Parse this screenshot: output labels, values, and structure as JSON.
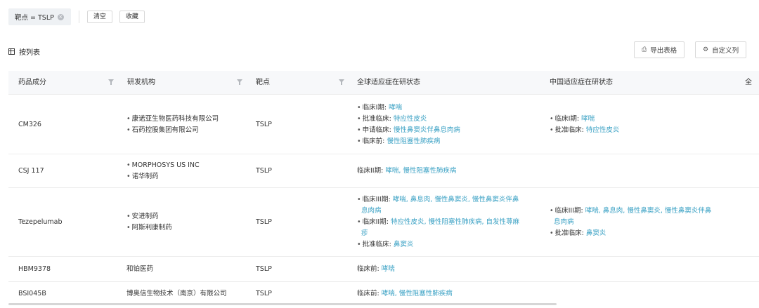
{
  "filter": {
    "tag": "靶点 = TSLP",
    "clear_label": "清空",
    "favorite_label": "收藏"
  },
  "section": {
    "title": "按列表"
  },
  "actions": {
    "export_label": "导出表格",
    "customize_label": "自定义列"
  },
  "table": {
    "columns": [
      "药品成分",
      "研发机构",
      "靶点",
      "全球适应症在研状态",
      "中国适应症在研状态",
      "全"
    ],
    "rows": [
      {
        "drug": "CM326",
        "orgs": [
          "康诺亚生物医药科技有限公司",
          "石药控股集团有限公司"
        ],
        "target": "TSLP",
        "global": [
          {
            "phase": "临床I期:",
            "indications": "哮喘"
          },
          {
            "phase": "批准临床:",
            "indications": "特应性皮炎"
          },
          {
            "phase": "申请临床:",
            "indications": "慢性鼻窦炎伴鼻息肉病"
          },
          {
            "phase": "临床前:",
            "indications": "慢性阻塞性肺疾病"
          }
        ],
        "china": [
          {
            "phase": "临床I期:",
            "indications": "哮喘"
          },
          {
            "phase": "批准临床:",
            "indications": "特应性皮炎"
          }
        ]
      },
      {
        "drug": "CSJ 117",
        "orgs": [
          "MORPHOSYS US INC",
          "诺华制药"
        ],
        "target": "TSLP",
        "global_plain": {
          "phase": "临床II期:",
          "indications": "哮喘, 慢性阻塞性肺疾病"
        }
      },
      {
        "drug": "Tezepelumab",
        "orgs": [
          "安进制药",
          "阿斯利康制药"
        ],
        "target": "TSLP",
        "global": [
          {
            "phase": "临床III期:",
            "ind_line1": "哮喘, 鼻息肉, 慢性鼻窦炎, 慢性鼻窦炎伴鼻",
            "ind_line2": "息肉病"
          },
          {
            "phase": "临床II期:",
            "ind_line1": "特应性皮炎, 慢性阻塞性肺疾病, 自发性荨麻",
            "ind_line2": "疹"
          },
          {
            "phase": "批准临床:",
            "ind_line1": "鼻窦炎",
            "ind_line2": ""
          }
        ],
        "china": [
          {
            "phase": "临床III期:",
            "ind_line1": "哮喘, 鼻息肉, 慢性鼻窦炎, 慢性鼻窦炎伴鼻",
            "ind_line2": "息肉病"
          },
          {
            "phase": "批准临床:",
            "ind_line1": "鼻窦炎",
            "ind_line2": ""
          }
        ]
      },
      {
        "drug": "HBM9378",
        "org": "和铂医药",
        "target": "TSLP",
        "global_plain": {
          "phase": "临床前:",
          "indications": "哮喘"
        }
      },
      {
        "drug": "BSI045B",
        "org": "博奥信生物技术（南京）有限公司",
        "target": "TSLP",
        "global_plain": {
          "phase": "临床前:",
          "indications": "哮喘, 慢性阻塞性肺疾病"
        }
      }
    ]
  },
  "colors": {
    "link": "#3aa1c4",
    "header_bg": "#f7f8fa",
    "tag_bg": "#eef1f4"
  }
}
